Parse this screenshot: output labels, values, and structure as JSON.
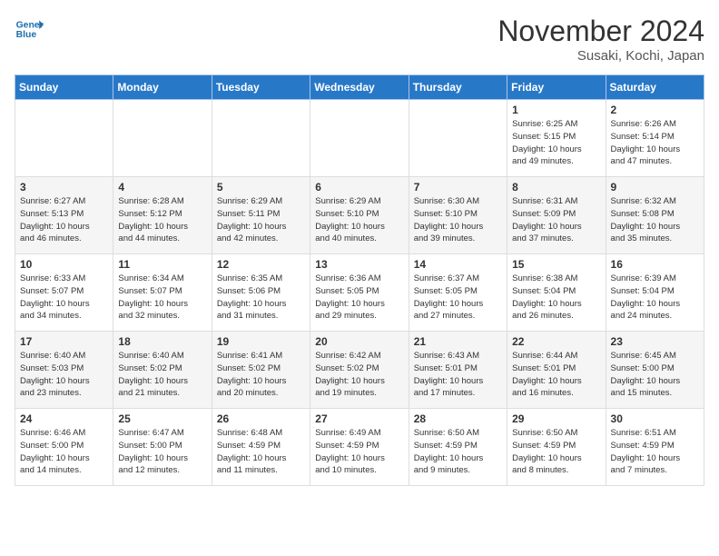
{
  "header": {
    "logo_line1": "General",
    "logo_line2": "Blue",
    "title": "November 2024",
    "subtitle": "Susaki, Kochi, Japan"
  },
  "weekdays": [
    "Sunday",
    "Monday",
    "Tuesday",
    "Wednesday",
    "Thursday",
    "Friday",
    "Saturday"
  ],
  "weeks": [
    [
      {
        "day": "",
        "info": ""
      },
      {
        "day": "",
        "info": ""
      },
      {
        "day": "",
        "info": ""
      },
      {
        "day": "",
        "info": ""
      },
      {
        "day": "",
        "info": ""
      },
      {
        "day": "1",
        "info": "Sunrise: 6:25 AM\nSunset: 5:15 PM\nDaylight: 10 hours\nand 49 minutes."
      },
      {
        "day": "2",
        "info": "Sunrise: 6:26 AM\nSunset: 5:14 PM\nDaylight: 10 hours\nand 47 minutes."
      }
    ],
    [
      {
        "day": "3",
        "info": "Sunrise: 6:27 AM\nSunset: 5:13 PM\nDaylight: 10 hours\nand 46 minutes."
      },
      {
        "day": "4",
        "info": "Sunrise: 6:28 AM\nSunset: 5:12 PM\nDaylight: 10 hours\nand 44 minutes."
      },
      {
        "day": "5",
        "info": "Sunrise: 6:29 AM\nSunset: 5:11 PM\nDaylight: 10 hours\nand 42 minutes."
      },
      {
        "day": "6",
        "info": "Sunrise: 6:29 AM\nSunset: 5:10 PM\nDaylight: 10 hours\nand 40 minutes."
      },
      {
        "day": "7",
        "info": "Sunrise: 6:30 AM\nSunset: 5:10 PM\nDaylight: 10 hours\nand 39 minutes."
      },
      {
        "day": "8",
        "info": "Sunrise: 6:31 AM\nSunset: 5:09 PM\nDaylight: 10 hours\nand 37 minutes."
      },
      {
        "day": "9",
        "info": "Sunrise: 6:32 AM\nSunset: 5:08 PM\nDaylight: 10 hours\nand 35 minutes."
      }
    ],
    [
      {
        "day": "10",
        "info": "Sunrise: 6:33 AM\nSunset: 5:07 PM\nDaylight: 10 hours\nand 34 minutes."
      },
      {
        "day": "11",
        "info": "Sunrise: 6:34 AM\nSunset: 5:07 PM\nDaylight: 10 hours\nand 32 minutes."
      },
      {
        "day": "12",
        "info": "Sunrise: 6:35 AM\nSunset: 5:06 PM\nDaylight: 10 hours\nand 31 minutes."
      },
      {
        "day": "13",
        "info": "Sunrise: 6:36 AM\nSunset: 5:05 PM\nDaylight: 10 hours\nand 29 minutes."
      },
      {
        "day": "14",
        "info": "Sunrise: 6:37 AM\nSunset: 5:05 PM\nDaylight: 10 hours\nand 27 minutes."
      },
      {
        "day": "15",
        "info": "Sunrise: 6:38 AM\nSunset: 5:04 PM\nDaylight: 10 hours\nand 26 minutes."
      },
      {
        "day": "16",
        "info": "Sunrise: 6:39 AM\nSunset: 5:04 PM\nDaylight: 10 hours\nand 24 minutes."
      }
    ],
    [
      {
        "day": "17",
        "info": "Sunrise: 6:40 AM\nSunset: 5:03 PM\nDaylight: 10 hours\nand 23 minutes."
      },
      {
        "day": "18",
        "info": "Sunrise: 6:40 AM\nSunset: 5:02 PM\nDaylight: 10 hours\nand 21 minutes."
      },
      {
        "day": "19",
        "info": "Sunrise: 6:41 AM\nSunset: 5:02 PM\nDaylight: 10 hours\nand 20 minutes."
      },
      {
        "day": "20",
        "info": "Sunrise: 6:42 AM\nSunset: 5:02 PM\nDaylight: 10 hours\nand 19 minutes."
      },
      {
        "day": "21",
        "info": "Sunrise: 6:43 AM\nSunset: 5:01 PM\nDaylight: 10 hours\nand 17 minutes."
      },
      {
        "day": "22",
        "info": "Sunrise: 6:44 AM\nSunset: 5:01 PM\nDaylight: 10 hours\nand 16 minutes."
      },
      {
        "day": "23",
        "info": "Sunrise: 6:45 AM\nSunset: 5:00 PM\nDaylight: 10 hours\nand 15 minutes."
      }
    ],
    [
      {
        "day": "24",
        "info": "Sunrise: 6:46 AM\nSunset: 5:00 PM\nDaylight: 10 hours\nand 14 minutes."
      },
      {
        "day": "25",
        "info": "Sunrise: 6:47 AM\nSunset: 5:00 PM\nDaylight: 10 hours\nand 12 minutes."
      },
      {
        "day": "26",
        "info": "Sunrise: 6:48 AM\nSunset: 4:59 PM\nDaylight: 10 hours\nand 11 minutes."
      },
      {
        "day": "27",
        "info": "Sunrise: 6:49 AM\nSunset: 4:59 PM\nDaylight: 10 hours\nand 10 minutes."
      },
      {
        "day": "28",
        "info": "Sunrise: 6:50 AM\nSunset: 4:59 PM\nDaylight: 10 hours\nand 9 minutes."
      },
      {
        "day": "29",
        "info": "Sunrise: 6:50 AM\nSunset: 4:59 PM\nDaylight: 10 hours\nand 8 minutes."
      },
      {
        "day": "30",
        "info": "Sunrise: 6:51 AM\nSunset: 4:59 PM\nDaylight: 10 hours\nand 7 minutes."
      }
    ]
  ]
}
